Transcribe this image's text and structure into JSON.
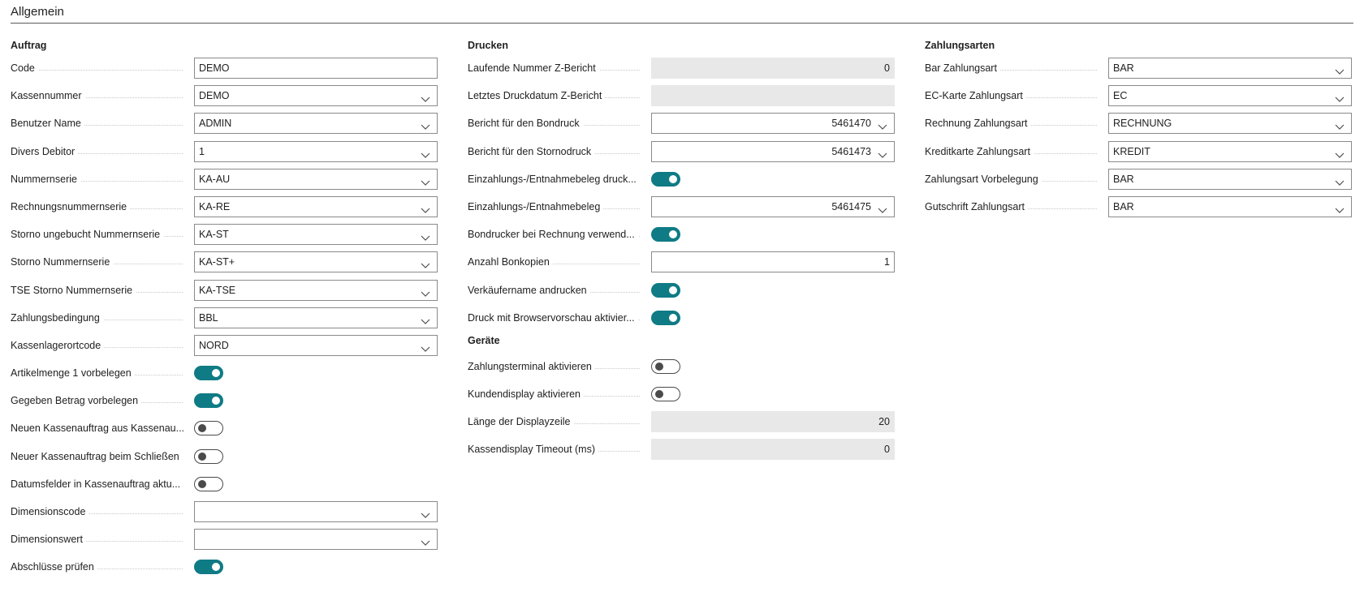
{
  "section": {
    "title": "Allgemein"
  },
  "colors": {
    "accent": "#0f7b85",
    "readonly_bg": "#e8e8e8"
  },
  "columns": [
    {
      "groups": [
        {
          "title": "Auftrag",
          "rows": [
            {
              "label": "Code",
              "type": "text",
              "value": "DEMO"
            },
            {
              "label": "Kassennummer",
              "type": "dropdown",
              "value": "DEMO"
            },
            {
              "label": "Benutzer Name",
              "type": "dropdown",
              "value": "ADMIN"
            },
            {
              "label": "Divers Debitor",
              "type": "dropdown",
              "value": "1"
            },
            {
              "label": "Nummernserie",
              "type": "dropdown",
              "value": "KA-AU"
            },
            {
              "label": "Rechnungsnummernserie",
              "type": "dropdown",
              "value": "KA-RE"
            },
            {
              "label": "Storno ungebucht Nummernserie",
              "type": "dropdown",
              "value": "KA-ST"
            },
            {
              "label": "Storno Nummernserie",
              "type": "dropdown",
              "value": "KA-ST+"
            },
            {
              "label": "TSE Storno Nummernserie",
              "type": "dropdown",
              "value": "KA-TSE"
            },
            {
              "label": "Zahlungsbedingung",
              "type": "dropdown",
              "value": "BBL"
            },
            {
              "label": "Kassenlagerortcode",
              "type": "dropdown",
              "value": "NORD"
            },
            {
              "label": "Artikelmenge 1 vorbelegen",
              "type": "toggle",
              "on": true
            },
            {
              "label": "Gegeben Betrag vorbelegen",
              "type": "toggle",
              "on": true
            },
            {
              "label": "Neuen Kassenauftrag aus Kassenau...",
              "type": "toggle",
              "on": false
            },
            {
              "label": "Neuer Kassenauftrag beim Schließen",
              "type": "toggle",
              "on": false
            },
            {
              "label": "Datumsfelder in Kassenauftrag aktu...",
              "type": "toggle",
              "on": false
            },
            {
              "label": "Dimensionscode",
              "type": "dropdown",
              "value": ""
            },
            {
              "label": "Dimensionswert",
              "type": "dropdown",
              "value": ""
            },
            {
              "label": "Abschlüsse prüfen",
              "type": "toggle",
              "on": true
            }
          ]
        }
      ]
    },
    {
      "groups": [
        {
          "title": "Drucken",
          "rows": [
            {
              "label": "Laufende Nummer Z-Bericht",
              "type": "readonly",
              "value": "0"
            },
            {
              "label": "Letztes Druckdatum Z-Bericht",
              "type": "readonly",
              "value": ""
            },
            {
              "label": "Bericht für den Bondruck",
              "type": "dropdown-num",
              "value": "5461470"
            },
            {
              "label": "Bericht für den Stornodruck",
              "type": "dropdown-num",
              "value": "5461473"
            },
            {
              "label": "Einzahlungs-/Entnahmebeleg druck...",
              "type": "toggle",
              "on": true
            },
            {
              "label": "Einzahlungs-/Entnahmebeleg",
              "type": "dropdown-num",
              "value": "5461475"
            },
            {
              "label": "Bondrucker bei Rechnung verwend...",
              "type": "toggle",
              "on": true
            },
            {
              "label": "Anzahl Bonkopien",
              "type": "number",
              "value": "1"
            },
            {
              "label": "Verkäufername andrucken",
              "type": "toggle",
              "on": true
            },
            {
              "label": "Druck mit Browservorschau aktivier...",
              "type": "toggle",
              "on": true
            }
          ]
        },
        {
          "title": "Geräte",
          "rows": [
            {
              "label": "Zahlungsterminal aktivieren",
              "type": "toggle",
              "on": false
            },
            {
              "label": "Kundendisplay aktivieren",
              "type": "toggle",
              "on": false
            },
            {
              "label": "Länge der Displayzeile",
              "type": "readonly",
              "value": "20"
            },
            {
              "label": "Kassendisplay Timeout (ms)",
              "type": "readonly",
              "value": "0"
            }
          ]
        }
      ]
    },
    {
      "groups": [
        {
          "title": "Zahlungsarten",
          "rows": [
            {
              "label": "Bar Zahlungsart",
              "type": "dropdown",
              "value": "BAR"
            },
            {
              "label": "EC-Karte Zahlungsart",
              "type": "dropdown",
              "value": "EC"
            },
            {
              "label": "Rechnung Zahlungsart",
              "type": "dropdown",
              "value": "RECHNUNG"
            },
            {
              "label": "Kreditkarte Zahlungsart",
              "type": "dropdown",
              "value": "KREDIT"
            },
            {
              "label": "Zahlungsart Vorbelegung",
              "type": "dropdown",
              "value": "BAR"
            },
            {
              "label": "Gutschrift Zahlungsart",
              "type": "dropdown",
              "value": "BAR"
            }
          ]
        }
      ]
    }
  ]
}
